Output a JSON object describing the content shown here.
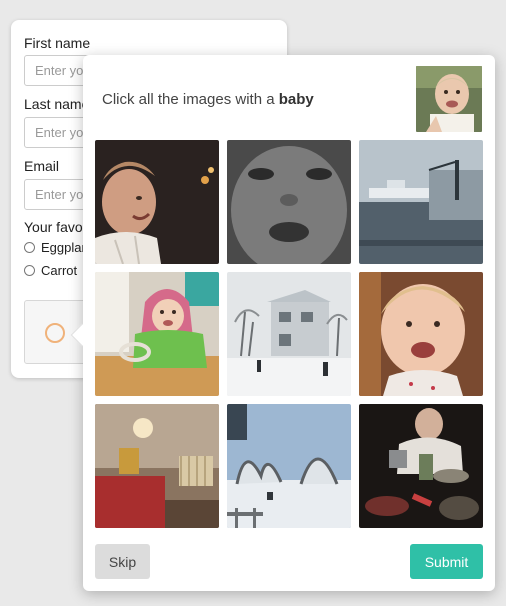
{
  "form": {
    "first_name_label": "First name",
    "first_name_placeholder": "Enter your first name",
    "last_name_label": "Last name",
    "last_name_placeholder": "Enter your last name",
    "email_label": "Email",
    "email_placeholder": "Enter your email",
    "favorite_label": "Your favorite vegetable",
    "options": [
      "Eggplant",
      "Carrot"
    ]
  },
  "challenge": {
    "prompt_prefix": "Click all the images with a",
    "target_word": "baby",
    "skip_label": "Skip",
    "submit_label": "Submit",
    "submit_color": "#2fc0a7",
    "tiles": [
      {
        "subject": "smiling-man-photo"
      },
      {
        "subject": "baby-face-closeup-bw"
      },
      {
        "subject": "harbor-ships"
      },
      {
        "subject": "baby-green-hoodie"
      },
      {
        "subject": "snowy-house"
      },
      {
        "subject": "laughing-baby"
      },
      {
        "subject": "bedroom-interior"
      },
      {
        "subject": "snowy-garden"
      },
      {
        "subject": "dinner-table"
      }
    ]
  }
}
